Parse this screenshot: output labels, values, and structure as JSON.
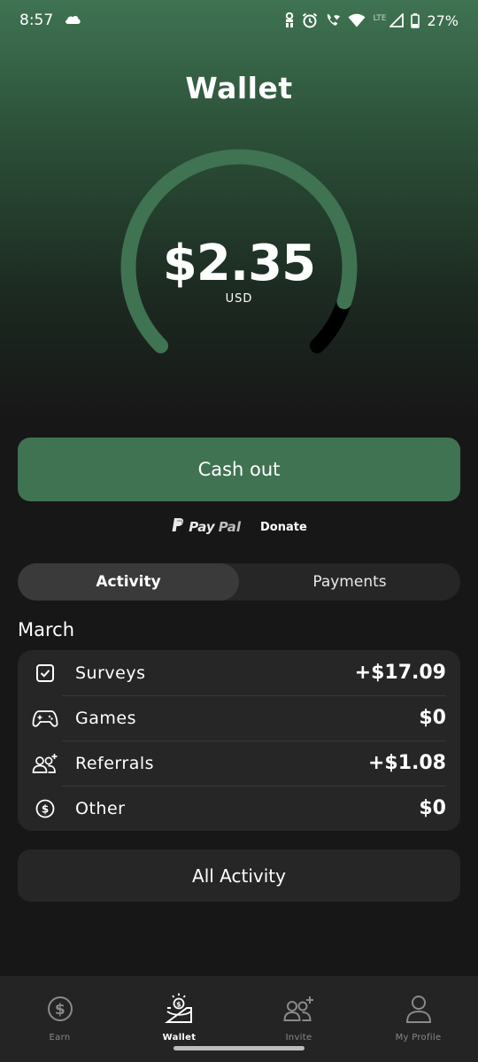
{
  "status_bar": {
    "time": "8:57",
    "network": "LTE",
    "battery": "27%",
    "icons": [
      "cloud-icon",
      "vpn-key-icon",
      "alarm-icon",
      "wifi-calling-icon",
      "wifi-icon",
      "signal-icon",
      "battery-icon"
    ]
  },
  "header": {
    "title": "Wallet"
  },
  "wallet": {
    "balance": "$2.35",
    "currency": "USD",
    "gauge_fill_fraction": 0.9,
    "accent_color": "#3f7352"
  },
  "cashout": {
    "button_label": "Cash out",
    "methods": {
      "paypal_pay": "Pay",
      "paypal_pal": "Pal",
      "donate": "Donate"
    }
  },
  "tabs": [
    {
      "label": "Activity",
      "active": true
    },
    {
      "label": "Payments",
      "active": false
    }
  ],
  "activity": {
    "month": "March",
    "rows": [
      {
        "icon": "checkbox-icon",
        "label": "Surveys",
        "value": "+$17.09"
      },
      {
        "icon": "gamepad-icon",
        "label": "Games",
        "value": "$0"
      },
      {
        "icon": "add-users-icon",
        "label": "Referrals",
        "value": "+$1.08"
      },
      {
        "icon": "dollar-circle-icon",
        "label": "Other",
        "value": "$0"
      }
    ],
    "all_button_label": "All Activity"
  },
  "bottom_nav": [
    {
      "icon": "dollar-circle-icon",
      "label": "Earn",
      "active": false
    },
    {
      "icon": "wallet-icon",
      "label": "Wallet",
      "active": true
    },
    {
      "icon": "add-users-icon",
      "label": "Invite",
      "active": false
    },
    {
      "icon": "person-icon",
      "label": "My Profile",
      "active": false
    }
  ]
}
